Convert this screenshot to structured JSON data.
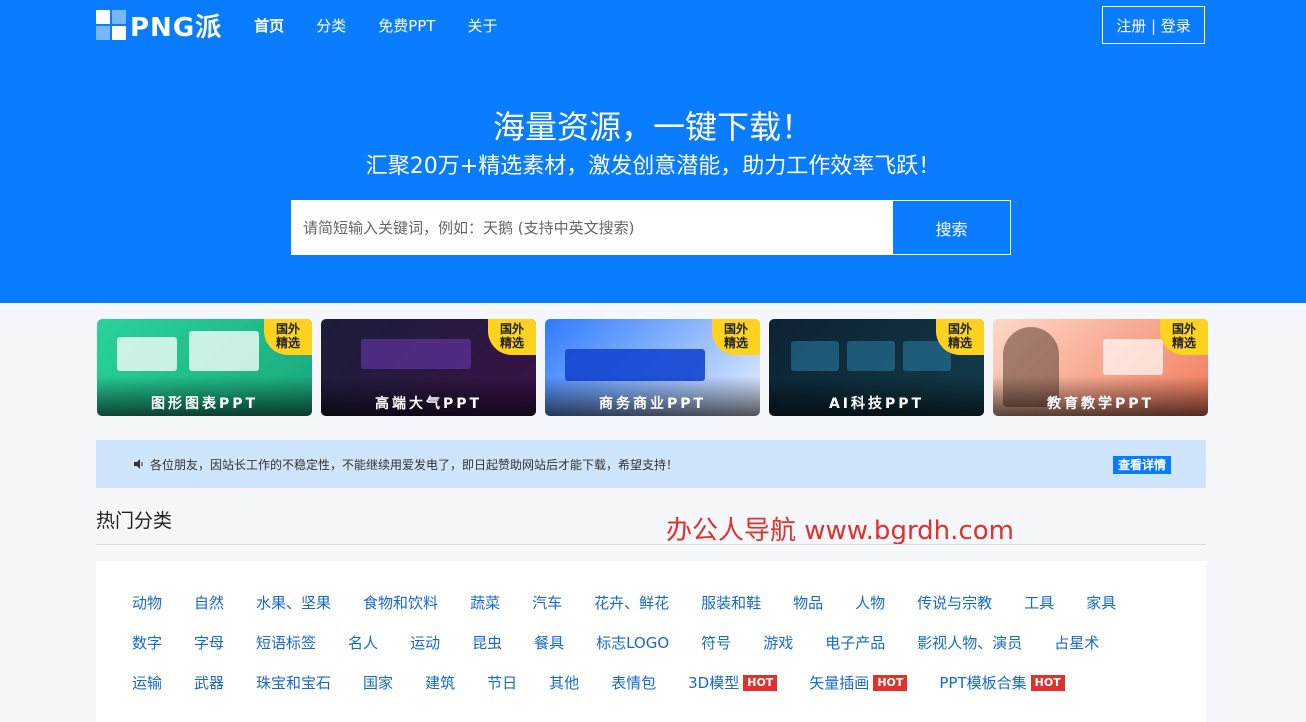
{
  "header": {
    "logo_text": "PNG派",
    "nav": [
      {
        "label": "首页",
        "active": true
      },
      {
        "label": "分类",
        "active": false
      },
      {
        "label": "免费PPT",
        "active": false
      },
      {
        "label": "关于",
        "active": false
      }
    ],
    "auth_label": "注册 | 登录"
  },
  "hero": {
    "title": "海量资源，一键下载！",
    "subtitle": "汇聚20万+精选素材，激发创意潜能，助力工作效率飞跃！",
    "search_placeholder": "请简短输入关键词，例如：天鹅 (支持中英文搜索)",
    "search_button": "搜索"
  },
  "cards": [
    {
      "badge": "国外\n精选",
      "caption": "图形图表PPT"
    },
    {
      "badge": "国外\n精选",
      "caption": "高端大气PPT"
    },
    {
      "badge": "国外\n精选",
      "caption": "商务商业PPT"
    },
    {
      "badge": "国外\n精选",
      "caption": "AI科技PPT"
    },
    {
      "badge": "国外\n精选",
      "caption": "教育教学PPT"
    }
  ],
  "notice": {
    "text": "各位朋友，因站长工作的不稳定性，不能继续用爱发电了，即日起赞助网站后才能下载，希望支持！",
    "button": "查看详情"
  },
  "section": {
    "title": "热门分类",
    "watermark": "办公人导航 www.bgrdh.com"
  },
  "categories": {
    "row1": [
      "动物",
      "自然",
      "水果、坚果",
      "食物和饮料",
      "蔬菜",
      "汽车",
      "花卉、鲜花",
      "服装和鞋",
      "物品",
      "人物",
      "传说与宗教",
      "工具",
      "家具"
    ],
    "row2": [
      "数字",
      "字母",
      "短语标签",
      "名人",
      "运动",
      "昆虫",
      "餐具",
      "标志LOGO",
      "符号",
      "游戏",
      "电子产品",
      "影视人物、演员",
      "占星术"
    ],
    "row3": [
      "运输",
      "武器",
      "珠宝和宝石",
      "国家",
      "建筑",
      "节日",
      "其他",
      "表情包"
    ],
    "row3_hot": [
      "3D模型",
      "矢量插画",
      "PPT模板合集"
    ],
    "hot_label": "HOT"
  },
  "colors": {
    "primary": "#0a7cff",
    "hot": "#e0322d",
    "link": "#1769d1",
    "notice_bg": "#cfe5fb"
  }
}
